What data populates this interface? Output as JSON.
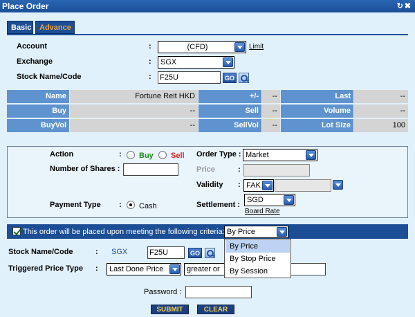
{
  "title": "Place Order",
  "title_icons": "↻✖",
  "tabs": {
    "basic": "Basic",
    "advance": "Advance"
  },
  "form": {
    "account_label": "Account",
    "account_value": "(CFD)",
    "limit_link": "Limit",
    "exchange_label": "Exchange",
    "exchange_value": "SGX",
    "stock_label": "Stock Name/Code",
    "stock_value": "F25U",
    "go_label": "GO",
    "colon": ":"
  },
  "quote": {
    "name_label": "Name",
    "name_value": "Fortune Reit HKD",
    "change_label": "+/-",
    "change_value": "--",
    "last_label": "Last",
    "last_value": "--",
    "buy_label": "Buy",
    "buy_value": "--",
    "sell_label": "Sell",
    "sell_value": "--",
    "volume_label": "Volume",
    "volume_value": "--",
    "buyvol_label": "BuyVol",
    "buyvol_value": "--",
    "sellvol_label": "SellVol",
    "sellvol_value": "--",
    "lotsize_label": "Lot Size",
    "lotsize_value": "100"
  },
  "order": {
    "action_label": "Action",
    "buy": "Buy",
    "sell": "Sell",
    "shares_label": "Number of Shares :",
    "payment_label": "Payment Type",
    "cash": "Cash",
    "order_type_label": "Order Type :",
    "order_type_value": "Market",
    "price_label": "Price",
    "validity_label": "Validity",
    "validity_value": "FAK",
    "settlement_label": "Settlement :",
    "settlement_value": "SGD",
    "board_rate": "Board Rate"
  },
  "criteria": {
    "text": "This order will be placed upon meeting the following criteria:",
    "selected": "By Price",
    "options": [
      "By Price",
      "By Stop Price",
      "By Session"
    ],
    "stock_label": "Stock Name/Code",
    "exchange": "SGX",
    "stock_value": "F25U",
    "trigger_label": "Triggered Price Type",
    "trigger_value": "Last Done Price",
    "condition_value": "greater or e"
  },
  "password_label": "Password :",
  "buttons": {
    "submit": "SUBMIT",
    "clear": "CLEAR"
  },
  "colors": {
    "header_blue": "#1c4e95",
    "quote_header": "#5f93cf",
    "buy_green": "#1a8c1a",
    "sell_red": "#e02020",
    "button_text": "#ffd24a"
  }
}
